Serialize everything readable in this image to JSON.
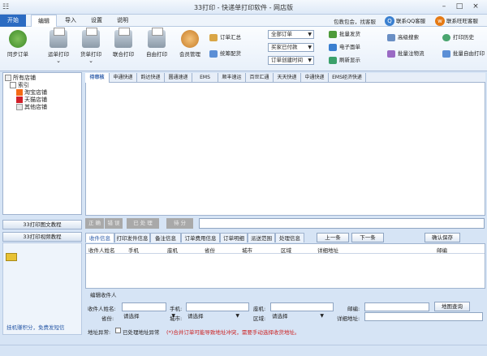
{
  "window": {
    "title": "33打印 - 快递单打印软件 - 网店版",
    "minimize": "–",
    "maximize": "□",
    "close": "×"
  },
  "menu": {
    "start": "开始",
    "edit": "编辑",
    "import": "导入",
    "settings": "设置",
    "help": "说明"
  },
  "topright": {
    "mail_label": "包教包会，找客服",
    "qq_label": "联系QQ客服",
    "wangwang_label": "联系旺旺客服"
  },
  "ribbon": {
    "sync_orders": "同步订单",
    "waybill_print": "运单打印",
    "invoice_print": "货单打印",
    "combined_print": "联合打印",
    "free_print": "自由打印",
    "member_manage": "会员管理",
    "order_summary": "订单汇总",
    "stock_match": "统筹配货",
    "filter_all_orders": "全部订单",
    "filter_buyer_paid": "买家已付款",
    "filter_order_time": "订单创建时间",
    "batch_ship": "批量发货",
    "e_waybill": "电子面单",
    "refresh_display": "刷新显示",
    "advanced_search": "高级搜索",
    "batch_logistics": "批量注物流",
    "print_history": "打印历史",
    "batch_free_print": "批量自由打印"
  },
  "tree": {
    "root": "所有店铺",
    "index": "索引",
    "taobao": "淘宝店铺",
    "tmall": "天猫店铺",
    "other": "其他店铺"
  },
  "left": {
    "tutorial_text": "33打印图文教程",
    "tutorial_video": "33打印视频教程",
    "footer": "挂机赚积分，免费发短信"
  },
  "carriers": [
    "待审核",
    "申通快递",
    "韵达快递",
    "圆通速递",
    "EMS",
    "顺丰速运",
    "百世汇通",
    "天天快递",
    "中通快递",
    "EMS经济快递"
  ],
  "actions": [
    "正 确",
    "错 误",
    "已 处 理",
    "待 分"
  ],
  "info_tabs": [
    "收件信息",
    "打印发件信息",
    "备注信息",
    "订单费用信息",
    "订单明细",
    "派送范围",
    "处理信息"
  ],
  "nav": {
    "prev": "上一条",
    "next": "下一条",
    "confirm_save": "确认保存"
  },
  "table_headers": [
    "收件人姓名",
    "手机",
    "座机",
    "省份",
    "城市",
    "区域",
    "详细地址",
    "邮编"
  ],
  "form": {
    "group_title": "编辑收件人",
    "name_label": "收件人姓名:",
    "mobile_label": "手机:",
    "phone_label": "座机:",
    "zip_label": "邮编:",
    "map_query": "地图查询",
    "province_label": "省份:",
    "city_label": "城市:",
    "area_label": "区域:",
    "province_value": "请选择",
    "city_value": "请选择",
    "area_value": "请选择",
    "address_label": "详细地址:",
    "addr_error_label": "地址异常:",
    "processed_label": "已处理地址异常",
    "warning": "(*)合并订单可能导致地址冲突，需要手动选择收货地址。"
  },
  "colors": {
    "accent": "#2b6bc2",
    "warning": "#cc2222"
  }
}
